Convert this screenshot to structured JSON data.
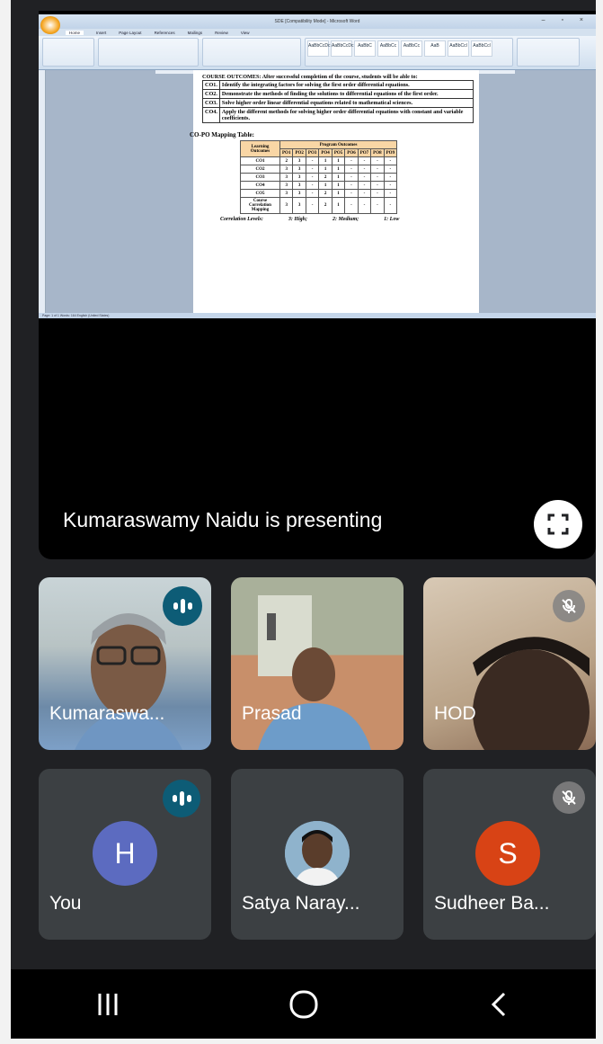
{
  "word": {
    "title": "SDE [Compatibility Mode] - Microsoft Word",
    "tabs": [
      "Home",
      "Insert",
      "Page Layout",
      "References",
      "Mailings",
      "Review",
      "View"
    ],
    "styles": [
      "AaBbCcDc",
      "AaBbCcDc",
      "AaBbC",
      "AaBbCc",
      "AaBbCc",
      "AaB",
      "AaBbCcl",
      "AaBbCcl"
    ],
    "course_outcomes_intro": "COURSE OUTCOMES: After successful completion of the course, students will be able to:",
    "course_outcomes": [
      {
        "code": "CO1.",
        "text": "Identify the integrating factors for solving the first order differential equations."
      },
      {
        "code": "CO2.",
        "text": "Demonstrate the methods of finding the solutions to differential equations of the first order."
      },
      {
        "code": "CO3.",
        "text": "Solve higher order linear differential equations related to mathematical sciences."
      },
      {
        "code": "CO4.",
        "text": "Apply the different methods for solving higher order differential equations with constant and variable coefficients."
      }
    ],
    "mapping_title": "CO-PO Mapping Table:",
    "mapping_header_lo": "Learning Outcomes",
    "mapping_header_po": "Program Outcomes",
    "po_labels": [
      "PO1",
      "PO2",
      "PO3",
      "PO4",
      "PO5",
      "PO6",
      "PO7",
      "PO8",
      "PO9"
    ],
    "mapping_rows": [
      {
        "label": "CO1",
        "values": [
          "2",
          "3",
          "-",
          "1",
          "1",
          "-",
          "-",
          "-",
          "-"
        ]
      },
      {
        "label": "CO2",
        "values": [
          "3",
          "3",
          "-",
          "1",
          "1",
          "-",
          "-",
          "-",
          "-"
        ]
      },
      {
        "label": "CO3",
        "values": [
          "3",
          "3",
          "-",
          "2",
          "1",
          "-",
          "-",
          "-",
          "-"
        ]
      },
      {
        "label": "CO4",
        "values": [
          "3",
          "3",
          "-",
          "1",
          "1",
          "-",
          "-",
          "-",
          "-"
        ]
      },
      {
        "label": "CO5",
        "values": [
          "3",
          "3",
          "-",
          "2",
          "1",
          "-",
          "-",
          "-",
          "-"
        ]
      },
      {
        "label": "Course Correlation Mapping",
        "values": [
          "3",
          "3",
          "-",
          "2",
          "1",
          "-",
          "-",
          "-",
          "-"
        ]
      }
    ],
    "correlation_levels": [
      "Correlation Levels:",
      "3: High;",
      "2: Medium;",
      "1: Low"
    ],
    "status": "Page: 1 of 1   Words: 164   English (United States)"
  },
  "presenter_label": "Kumaraswamy Naidu is presenting",
  "participants": [
    {
      "name": "Kumaraswa...",
      "state": "speaking"
    },
    {
      "name": "Prasad",
      "state": "none"
    },
    {
      "name": "HOD",
      "state": "muted"
    },
    {
      "name": "You",
      "initial": "H",
      "state": "speaking",
      "color": "#5c6bc0"
    },
    {
      "name": "Satya Naray...",
      "state": "none"
    },
    {
      "name": "Sudheer Ba...",
      "initial": "S",
      "state": "muted",
      "color": "#d84315"
    }
  ],
  "colors": {
    "tile": "#3c4043",
    "background": "#202124",
    "speaking": "#0d5c76"
  }
}
